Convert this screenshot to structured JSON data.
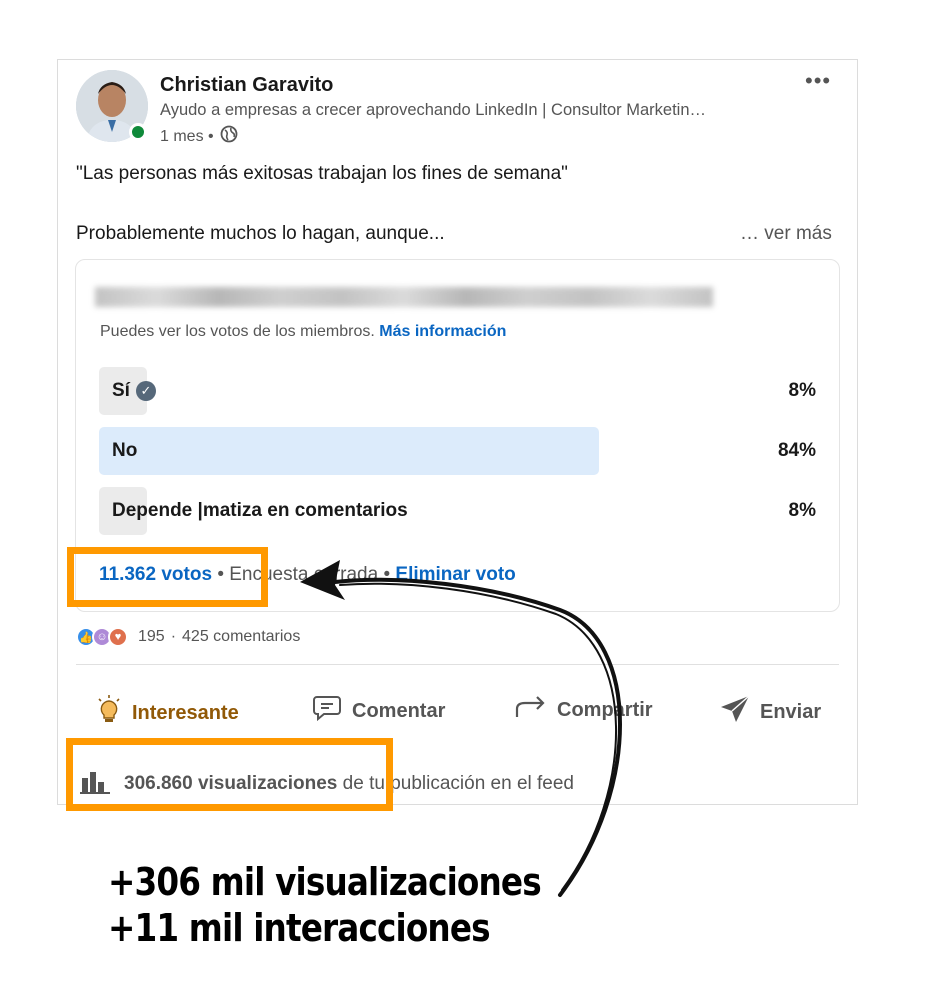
{
  "post": {
    "author_name": "Christian Garavito",
    "author_headline": "Ayudo a empresas a crecer aprovechando LinkedIn | Consultor Marketin…",
    "time": "1 mes •",
    "more_label": "•••",
    "text_quote": "\"Las personas más exitosas trabajan los fines de semana\"",
    "text_teaser": "Probablemente muchos lo hagan, aunque...",
    "see_more": "… ver más"
  },
  "poll": {
    "visibility_note": "Puedes ver los votos de los miembros.",
    "more_info_link": "Más información",
    "options": [
      {
        "label": "Sí",
        "percent": "8%",
        "share": 0.08,
        "selected": true
      },
      {
        "label": "No",
        "percent": "84%",
        "share": 0.84,
        "selected": false
      },
      {
        "label": "Depende |matiza en comentarios",
        "percent": "8%",
        "share": 0.08,
        "selected": false
      }
    ],
    "votes": "11.362 votos",
    "separator": "•",
    "status": "Encuesta cerrada",
    "remove_vote": "Eliminar voto"
  },
  "social": {
    "reaction_count": "195",
    "comments": "425 comentarios"
  },
  "actions": {
    "reaction": "Interesante",
    "comment": "Comentar",
    "share": "Compartir",
    "send": "Enviar"
  },
  "analytics": {
    "views": "306.860 visualizaciones",
    "views_suffix": "de tu publicación en el feed"
  },
  "caption": {
    "line1": "+306 mil visualizaciones",
    "line2": "+11 mil interacciones"
  },
  "colors": {
    "accent_blue": "#0a66c2",
    "highlight_orange": "#ff9900",
    "reaction_orange": "#915907",
    "poll_selected_bar": "#dcebfb",
    "poll_bar": "#ebebeb"
  },
  "icons": [
    "globe-icon",
    "check-icon",
    "like-icon",
    "insightful-icon",
    "love-icon",
    "bulb-icon",
    "comment-icon",
    "share-icon",
    "send-icon",
    "bar-chart-icon"
  ]
}
